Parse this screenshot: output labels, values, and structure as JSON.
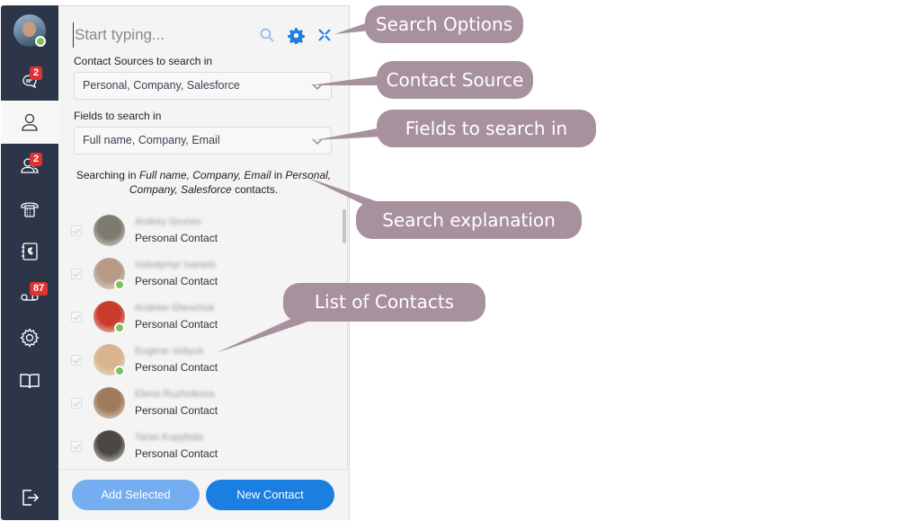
{
  "sidebar": {
    "user_avatar": {
      "status": "online"
    },
    "items": [
      {
        "id": "chats",
        "icon": "chat-bubbles-icon",
        "badge": "2"
      },
      {
        "id": "contacts",
        "icon": "user-icon",
        "active": true
      },
      {
        "id": "groups",
        "icon": "users-icon",
        "badge": "2"
      },
      {
        "id": "dialpad",
        "icon": "phone-dialpad-icon"
      },
      {
        "id": "phonebook",
        "icon": "phonebook-icon"
      },
      {
        "id": "voicemail",
        "icon": "voicemail-icon",
        "badge": "87"
      },
      {
        "id": "settings",
        "icon": "gear-icon"
      },
      {
        "id": "help",
        "icon": "book-icon"
      },
      {
        "id": "logout",
        "icon": "logout-icon"
      }
    ]
  },
  "search": {
    "placeholder": "Start typing...",
    "value": "",
    "icons": [
      "search-icon",
      "gear-icon",
      "collapse-icon"
    ]
  },
  "sources": {
    "label": "Contact Sources to search in",
    "selected": "Personal, Company, Salesforce"
  },
  "fields": {
    "label": "Fields to search in",
    "selected": "Full name, Company, Email"
  },
  "explanation": {
    "prefix": "Searching in ",
    "fields": "Full name, Company, Email",
    "middle": " in ",
    "sources": "Personal, Company, Salesforce",
    "suffix": " contacts."
  },
  "contacts": [
    {
      "name": "Andrey Grunev",
      "type": "Personal Contact",
      "online": false,
      "avatar_color": "#7d7a70"
    },
    {
      "name": "Volodymyr Ivanets",
      "type": "Personal Contact",
      "online": true,
      "avatar_color": "#b79a86"
    },
    {
      "name": "Andrew Shevchuk",
      "type": "Personal Contact",
      "online": true,
      "avatar_color": "#c83a2a"
    },
    {
      "name": "Eugene Voityuk",
      "type": "Personal Contact",
      "online": true,
      "avatar_color": "#d9b48e"
    },
    {
      "name": "Elena Ruzhnikova",
      "type": "Personal Contact",
      "online": false,
      "avatar_color": "#a07a5c"
    },
    {
      "name": "Taras Kupybida",
      "type": "Personal Contact",
      "online": false,
      "avatar_color": "#4a4744"
    }
  ],
  "footer": {
    "add_selected": "Add Selected",
    "new_contact": "New Contact"
  },
  "callouts": {
    "search_options": "Search Options",
    "contact_source": "Contact Source",
    "fields_to_search": "Fields to search in",
    "search_explanation": "Search explanation",
    "list_of_contacts": "List of Contacts"
  },
  "colors": {
    "sidebar_bg": "#2d3648",
    "accent_blue": "#1a7fe0",
    "badge_red": "#e03232",
    "online_green": "#7cc25a",
    "callout_bg": "#a8919f"
  }
}
